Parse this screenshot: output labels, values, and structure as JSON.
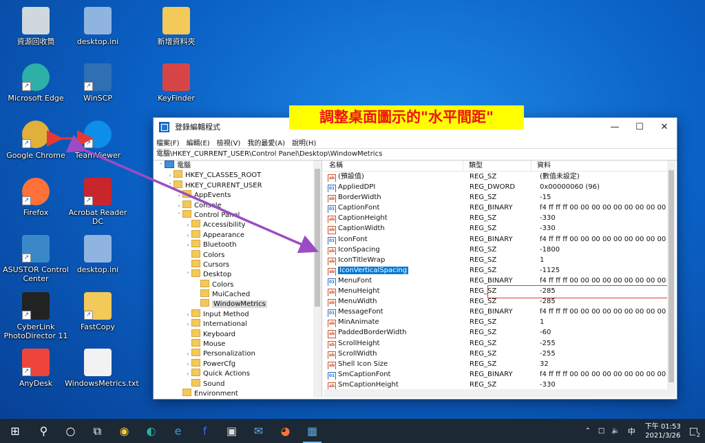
{
  "desktop": {
    "icons": [
      {
        "label": "資源回收筒",
        "icon": "recycle-bin-icon"
      },
      {
        "label": "desktop.ini",
        "icon": "ini-file-icon"
      },
      {
        "label": "新增資料夾",
        "icon": "folder-icon"
      },
      {
        "label": "Microsoft Edge",
        "icon": "edge-icon"
      },
      {
        "label": "WinSCP",
        "icon": "winscp-icon"
      },
      {
        "label": "KeyFinder",
        "icon": "keyfinder-icon"
      },
      {
        "label": "Google Chrome",
        "icon": "chrome-icon"
      },
      {
        "label": "TeamViewer",
        "icon": "teamviewer-icon"
      },
      {
        "label": "Firefox",
        "icon": "firefox-icon"
      },
      {
        "label": "Acrobat Reader DC",
        "icon": "acrobat-icon"
      },
      {
        "label": "ASUSTOR Control Center",
        "icon": "asustor-icon"
      },
      {
        "label": "desktop.ini",
        "icon": "ini-file-icon"
      },
      {
        "label": "CyberLink PhotoDirector 11",
        "icon": "photodirector-icon"
      },
      {
        "label": "FastCopy",
        "icon": "fastcopy-icon"
      },
      {
        "label": "AnyDesk",
        "icon": "anydesk-icon"
      },
      {
        "label": "WindowsMetrics.txt",
        "icon": "text-file-icon"
      }
    ]
  },
  "callout": {
    "text": "調整桌面圖示的\"水平間距\""
  },
  "window": {
    "title": "登錄編輯程式",
    "menu": [
      "檔案(F)",
      "編輯(E)",
      "檢視(V)",
      "我的最愛(A)",
      "說明(H)"
    ],
    "address": "電腦\\HKEY_CURRENT_USER\\Control Panel\\Desktop\\WindowMetrics",
    "tree": [
      {
        "label": "電腦",
        "depth": 0,
        "arrow": "˅",
        "icon": "computer"
      },
      {
        "label": "HKEY_CLASSES_ROOT",
        "depth": 1,
        "arrow": "›",
        "icon": "folder"
      },
      {
        "label": "HKEY_CURRENT_USER",
        "depth": 1,
        "arrow": "˅",
        "icon": "folder"
      },
      {
        "label": "AppEvents",
        "depth": 2,
        "arrow": "›",
        "icon": "folder"
      },
      {
        "label": "Console",
        "depth": 2,
        "arrow": "›",
        "icon": "folder"
      },
      {
        "label": "Control Panel",
        "depth": 2,
        "arrow": "˅",
        "icon": "folder"
      },
      {
        "label": "Accessibility",
        "depth": 3,
        "arrow": "›",
        "icon": "folder"
      },
      {
        "label": "Appearance",
        "depth": 3,
        "arrow": "›",
        "icon": "folder"
      },
      {
        "label": "Bluetooth",
        "depth": 3,
        "arrow": "›",
        "icon": "folder"
      },
      {
        "label": "Colors",
        "depth": 3,
        "arrow": "",
        "icon": "folder"
      },
      {
        "label": "Cursors",
        "depth": 3,
        "arrow": "",
        "icon": "folder"
      },
      {
        "label": "Desktop",
        "depth": 3,
        "arrow": "˅",
        "icon": "folder"
      },
      {
        "label": "Colors",
        "depth": 4,
        "arrow": "",
        "icon": "folder"
      },
      {
        "label": "MuiCached",
        "depth": 4,
        "arrow": "",
        "icon": "folder"
      },
      {
        "label": "WindowMetrics",
        "depth": 4,
        "arrow": "",
        "icon": "folder",
        "selected": true
      },
      {
        "label": "Input Method",
        "depth": 3,
        "arrow": "›",
        "icon": "folder"
      },
      {
        "label": "International",
        "depth": 3,
        "arrow": "›",
        "icon": "folder"
      },
      {
        "label": "Keyboard",
        "depth": 3,
        "arrow": "",
        "icon": "folder"
      },
      {
        "label": "Mouse",
        "depth": 3,
        "arrow": "",
        "icon": "folder"
      },
      {
        "label": "Personalization",
        "depth": 3,
        "arrow": "›",
        "icon": "folder"
      },
      {
        "label": "PowerCfg",
        "depth": 3,
        "arrow": "›",
        "icon": "folder"
      },
      {
        "label": "Quick Actions",
        "depth": 3,
        "arrow": "›",
        "icon": "folder"
      },
      {
        "label": "Sound",
        "depth": 3,
        "arrow": "",
        "icon": "folder"
      },
      {
        "label": "Environment",
        "depth": 2,
        "arrow": "",
        "icon": "folder"
      }
    ],
    "columns": [
      "名稱",
      "類型",
      "資料"
    ],
    "values": [
      {
        "name": "(預設值)",
        "type": "REG_SZ",
        "data": "(數值未設定)"
      },
      {
        "name": "AppliedDPI",
        "type": "REG_DWORD",
        "data": "0x00000060 (96)"
      },
      {
        "name": "BorderWidth",
        "type": "REG_SZ",
        "data": "-15"
      },
      {
        "name": "CaptionFont",
        "type": "REG_BINARY",
        "data": "f4 ff ff ff 00 00 00 00 00 00 00 00 00 00 00 0"
      },
      {
        "name": "CaptionHeight",
        "type": "REG_SZ",
        "data": "-330"
      },
      {
        "name": "CaptionWidth",
        "type": "REG_SZ",
        "data": "-330"
      },
      {
        "name": "IconFont",
        "type": "REG_BINARY",
        "data": "f4 ff ff ff 00 00 00 00 00 00 00 00 00 00 00 0"
      },
      {
        "name": "IconSpacing",
        "type": "REG_SZ",
        "data": "-1800"
      },
      {
        "name": "IconTitleWrap",
        "type": "REG_SZ",
        "data": "1"
      },
      {
        "name": "IconVerticalSpacing",
        "type": "REG_SZ",
        "data": "-1125",
        "highlighted": true
      },
      {
        "name": "MenuFont",
        "type": "REG_BINARY",
        "data": "f4 ff ff ff 00 00 00 00 00 00 00 00 00 00 00 0"
      },
      {
        "name": "MenuHeight",
        "type": "REG_SZ",
        "data": "-285"
      },
      {
        "name": "MenuWidth",
        "type": "REG_SZ",
        "data": "-285"
      },
      {
        "name": "MessageFont",
        "type": "REG_BINARY",
        "data": "f4 ff ff ff 00 00 00 00 00 00 00 00 00 00 00 0"
      },
      {
        "name": "MinAnimate",
        "type": "REG_SZ",
        "data": "1"
      },
      {
        "name": "PaddedBorderWidth",
        "type": "REG_SZ",
        "data": "-60"
      },
      {
        "name": "ScrollHeight",
        "type": "REG_SZ",
        "data": "-255"
      },
      {
        "name": "ScrollWidth",
        "type": "REG_SZ",
        "data": "-255"
      },
      {
        "name": "Shell Icon Size",
        "type": "REG_SZ",
        "data": "32"
      },
      {
        "name": "SmCaptionFont",
        "type": "REG_BINARY",
        "data": "f4 ff ff ff 00 00 00 00 00 00 00 00 00 00 00 0"
      },
      {
        "name": "SmCaptionHeight",
        "type": "REG_SZ",
        "data": "-330"
      }
    ]
  },
  "taskbar": {
    "apps": [
      "start-icon",
      "search-icon",
      "cortana-icon",
      "task-view-icon",
      "chrome-icon",
      "edge-icon",
      "ie-icon",
      "facebook-icon",
      "store-icon",
      "mail-icon",
      "firefox-icon",
      "regedit-icon"
    ],
    "tray_lang": "中",
    "time": "下午 01:53",
    "date": "2021/3/26",
    "notify_count": "2"
  },
  "colors": {
    "accent": "#0078d7",
    "callout_bg": "#ffff00",
    "callout_text": "#ee1111",
    "annotation_box": "#e53935",
    "arrow_red": "#e53935",
    "arrow_purple": "#9b4cc4"
  }
}
